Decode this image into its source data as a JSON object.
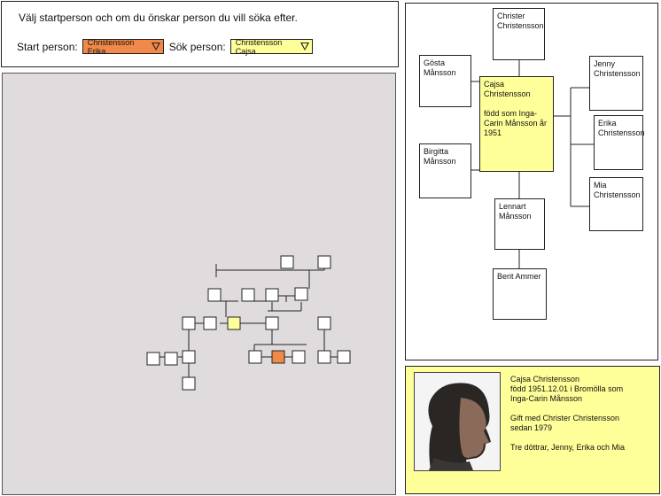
{
  "instruction": "Välj startperson och om du önskar person du vill söka efter.",
  "start": {
    "label": "Start person:",
    "value": "Christensson Erika",
    "color": "#f0894a"
  },
  "sok": {
    "label": "Sök person:",
    "value": "Christensson Cajsa",
    "color": "#ffff99"
  },
  "tree": {
    "father": "Christer Christensson",
    "left_top": "Gösta Månsson",
    "left_bottom": "Birgitta Månsson",
    "center_name": "Cajsa Christensson",
    "center_born": "född som Inga-Carin Månsson år 1951",
    "child1": "Jenny Christensson",
    "child2": "Erika Christensson",
    "child3": "Mia Christensson",
    "below1": "Lennart Månsson",
    "below2": "Berit Ammer"
  },
  "info": {
    "line1": "Cajsa Christensson",
    "line2": "född 1951.12.01 i Bromölla som",
    "line3": "Inga-Carin Månsson",
    "line4": "Gift med Christer Christensson",
    "line5": "sedan 1979",
    "line6": "Tre döttrar, Jenny, Erika och Mia"
  },
  "colors": {
    "highlight_search": "#ffff99",
    "highlight_start": "#f0894a",
    "map_bg": "#e0dcdd"
  }
}
